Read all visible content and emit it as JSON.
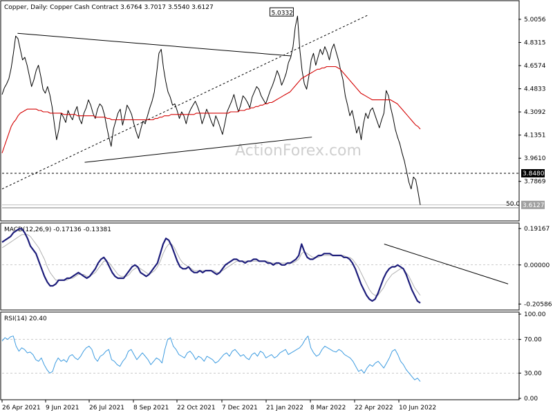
{
  "colors": {
    "price": "#000000",
    "ma": "#d40000",
    "macd": "#1c1c7a",
    "macd_signal": "#b0b0b0",
    "rsi": "#3c9be0",
    "watermark": "#c8c8c8",
    "price_box_bg": "#000000",
    "price_box_bg2": "#a0a0a0"
  },
  "chart_data": [
    {
      "type": "line",
      "panel": "price",
      "title": "Copper, Daily:  Copper Cash Contract  3.6764 3.7017 3.5540 3.6127",
      "watermark": "ActionForex.com",
      "ylim": [
        3.5,
        5.13
      ],
      "y_ticks": [
        "5.0056",
        "4.8315",
        "4.6574",
        "4.4833",
        "4.3092",
        "4.1351",
        "3.9610",
        "3.7869"
      ],
      "x_ticks": [
        "26 Apr 2021",
        "9 Jun 2021",
        "26 Jul 2021",
        "8 Sep 2021",
        "22 Oct 2021",
        "7 Dec 2021",
        "21 Jan 2022",
        "8 Mar 2022",
        "22 Apr 2022",
        "10 Jun 2022"
      ],
      "series": [
        {
          "values": [
            4.44,
            4.49,
            4.52,
            4.56,
            4.64,
            4.75,
            4.88,
            4.86,
            4.78,
            4.7,
            4.72,
            4.66,
            4.58,
            4.5,
            4.55,
            4.62,
            4.66,
            4.58,
            4.48,
            4.45,
            4.5,
            4.44,
            4.35,
            4.22,
            4.1,
            4.18,
            4.3,
            4.27,
            4.23,
            4.32,
            4.28,
            4.25,
            4.31,
            4.35,
            4.26,
            4.22,
            4.3,
            4.34,
            4.4,
            4.36,
            4.3,
            4.26,
            4.33,
            4.37,
            4.35,
            4.29,
            4.2,
            4.12,
            4.05,
            4.18,
            4.24,
            4.3,
            4.33,
            4.21,
            4.28,
            4.36,
            4.33,
            4.29,
            4.22,
            4.16,
            4.11,
            4.18,
            4.24,
            4.22,
            4.28,
            4.34,
            4.39,
            4.46,
            4.6,
            4.75,
            4.78,
            4.64,
            4.54,
            4.46,
            4.42,
            4.36,
            4.37,
            4.32,
            4.26,
            4.31,
            4.28,
            4.22,
            4.29,
            4.33,
            4.36,
            4.39,
            4.35,
            4.3,
            4.22,
            4.27,
            4.33,
            4.29,
            4.24,
            4.2,
            4.28,
            4.24,
            4.19,
            4.14,
            4.22,
            4.31,
            4.35,
            4.39,
            4.44,
            4.37,
            4.31,
            4.36,
            4.43,
            4.41,
            4.38,
            4.34,
            4.42,
            4.46,
            4.5,
            4.48,
            4.43,
            4.4,
            4.37,
            4.42,
            4.47,
            4.51,
            4.56,
            4.62,
            4.58,
            4.51,
            4.55,
            4.6,
            4.68,
            4.72,
            4.8,
            4.95,
            5.03,
            4.78,
            4.62,
            4.52,
            4.48,
            4.58,
            4.7,
            4.75,
            4.66,
            4.72,
            4.78,
            4.74,
            4.8,
            4.76,
            4.7,
            4.78,
            4.82,
            4.76,
            4.7,
            4.62,
            4.55,
            4.43,
            4.36,
            4.28,
            4.32,
            4.24,
            4.15,
            4.2,
            4.1,
            4.22,
            4.3,
            4.26,
            4.32,
            4.34,
            4.29,
            4.24,
            4.19,
            4.25,
            4.3,
            4.47,
            4.43,
            4.34,
            4.27,
            4.18,
            4.12,
            4.07,
            4.0,
            3.94,
            3.86,
            3.78,
            3.73,
            3.82,
            3.8,
            3.71,
            3.61
          ]
        },
        {
          "name": "MA",
          "values": [
            4.0,
            4.05,
            4.1,
            4.15,
            4.2,
            4.23,
            4.25,
            4.28,
            4.3,
            4.31,
            4.32,
            4.33,
            4.33,
            4.33,
            4.33,
            4.33,
            4.32,
            4.32,
            4.31,
            4.31,
            4.31,
            4.3,
            4.3,
            4.3,
            4.3,
            4.3,
            4.3,
            4.29,
            4.29,
            4.29,
            4.29,
            4.29,
            4.29,
            4.28,
            4.28,
            4.28,
            4.28,
            4.28,
            4.28,
            4.28,
            4.28,
            4.27,
            4.27,
            4.27,
            4.27,
            4.27,
            4.26,
            4.26,
            4.25,
            4.25,
            4.25,
            4.25,
            4.25,
            4.25,
            4.25,
            4.25,
            4.25,
            4.25,
            4.25,
            4.25,
            4.25,
            4.25,
            4.25,
            4.25,
            4.25,
            4.25,
            4.25,
            4.26,
            4.26,
            4.27,
            4.27,
            4.28,
            4.28,
            4.28,
            4.29,
            4.29,
            4.29,
            4.29,
            4.29,
            4.29,
            4.29,
            4.29,
            4.29,
            4.29,
            4.29,
            4.3,
            4.3,
            4.3,
            4.3,
            4.3,
            4.3,
            4.3,
            4.3,
            4.3,
            4.3,
            4.3,
            4.3,
            4.3,
            4.3,
            4.3,
            4.31,
            4.31,
            4.31,
            4.31,
            4.32,
            4.32,
            4.32,
            4.33,
            4.33,
            4.34,
            4.34,
            4.35,
            4.35,
            4.36,
            4.36,
            4.37,
            4.37,
            4.38,
            4.38,
            4.39,
            4.4,
            4.41,
            4.42,
            4.43,
            4.44,
            4.45,
            4.46,
            4.48,
            4.5,
            4.52,
            4.54,
            4.56,
            4.57,
            4.58,
            4.59,
            4.6,
            4.61,
            4.62,
            4.63,
            4.63,
            4.64,
            4.64,
            4.65,
            4.65,
            4.65,
            4.65,
            4.65,
            4.64,
            4.63,
            4.61,
            4.59,
            4.57,
            4.55,
            4.53,
            4.51,
            4.49,
            4.47,
            4.45,
            4.44,
            4.43,
            4.42,
            4.41,
            4.4,
            4.4,
            4.4,
            4.4,
            4.4,
            4.4,
            4.4,
            4.4,
            4.4,
            4.39,
            4.38,
            4.37,
            4.35,
            4.33,
            4.31,
            4.29,
            4.27,
            4.25,
            4.23,
            4.21,
            4.2,
            4.18
          ]
        }
      ],
      "annotations": [
        {
          "text": "5.0332"
        },
        {
          "text": "3.8480"
        },
        {
          "text": "3.6127"
        },
        {
          "text": "50.0"
        }
      ],
      "trendlines": [
        {
          "from": [
            0.03,
            4.9
          ],
          "to": [
            0.56,
            4.73
          ]
        },
        {
          "from": [
            0.16,
            3.93
          ],
          "to": [
            0.6,
            4.12
          ]
        },
        {
          "from": [
            0.0,
            3.73
          ],
          "to": [
            0.71,
            5.04
          ],
          "dashed": true
        },
        {
          "from": [
            0.0,
            3.848
          ],
          "to": [
            1.0,
            3.848
          ],
          "dashed": true
        }
      ]
    },
    {
      "type": "line",
      "panel": "macd",
      "title": "MACD(12,26,9) -0.17136 -0.13381",
      "ylim": [
        -0.23,
        0.21
      ],
      "y_ticks": [
        "0.19167",
        "0.00000",
        "-0.20586"
      ],
      "series": [
        {
          "name": "MACD",
          "values": [
            0.12,
            0.13,
            0.14,
            0.15,
            0.17,
            0.18,
            0.19,
            0.19,
            0.17,
            0.14,
            0.1,
            0.08,
            0.06,
            0.02,
            -0.02,
            -0.06,
            -0.09,
            -0.11,
            -0.11,
            -0.1,
            -0.08,
            -0.08,
            -0.08,
            -0.07,
            -0.07,
            -0.06,
            -0.05,
            -0.04,
            -0.05,
            -0.06,
            -0.07,
            -0.06,
            -0.04,
            -0.02,
            0.01,
            0.03,
            0.04,
            0.02,
            -0.01,
            -0.04,
            -0.06,
            -0.07,
            -0.07,
            -0.07,
            -0.05,
            -0.03,
            -0.01,
            0.0,
            -0.01,
            -0.04,
            -0.05,
            -0.06,
            -0.05,
            -0.03,
            -0.01,
            0.01,
            0.06,
            0.11,
            0.14,
            0.13,
            0.1,
            0.06,
            0.02,
            -0.01,
            -0.02,
            -0.02,
            -0.01,
            -0.03,
            -0.04,
            -0.04,
            -0.03,
            -0.04,
            -0.03,
            -0.03,
            -0.03,
            -0.04,
            -0.05,
            -0.04,
            -0.02,
            0.0,
            0.01,
            0.02,
            0.03,
            0.03,
            0.02,
            0.02,
            0.01,
            0.02,
            0.02,
            0.03,
            0.03,
            0.02,
            0.02,
            0.02,
            0.01,
            0.01,
            0.0,
            0.01,
            0.01,
            0.0,
            0.0,
            0.01,
            0.01,
            0.02,
            0.03,
            0.05,
            0.11,
            0.07,
            0.04,
            0.03,
            0.03,
            0.04,
            0.05,
            0.05,
            0.06,
            0.06,
            0.06,
            0.05,
            0.05,
            0.05,
            0.05,
            0.04,
            0.04,
            0.03,
            0.01,
            -0.02,
            -0.06,
            -0.1,
            -0.13,
            -0.16,
            -0.18,
            -0.19,
            -0.18,
            -0.15,
            -0.11,
            -0.07,
            -0.04,
            -0.02,
            -0.01,
            -0.01,
            0.0,
            -0.01,
            -0.02,
            -0.05,
            -0.09,
            -0.13,
            -0.16,
            -0.19,
            -0.2
          ]
        },
        {
          "name": "Signal",
          "values": [
            0.09,
            0.1,
            0.11,
            0.12,
            0.13,
            0.14,
            0.15,
            0.16,
            0.16,
            0.16,
            0.15,
            0.13,
            0.11,
            0.09,
            0.06,
            0.03,
            -0.01,
            -0.04,
            -0.06,
            -0.08,
            -0.08,
            -0.08,
            -0.08,
            -0.08,
            -0.07,
            -0.07,
            -0.06,
            -0.05,
            -0.05,
            -0.05,
            -0.06,
            -0.06,
            -0.05,
            -0.04,
            -0.02,
            0.0,
            0.02,
            0.02,
            0.01,
            -0.01,
            -0.03,
            -0.05,
            -0.06,
            -0.06,
            -0.06,
            -0.05,
            -0.03,
            -0.02,
            -0.01,
            -0.02,
            -0.03,
            -0.04,
            -0.05,
            -0.04,
            -0.03,
            -0.01,
            0.02,
            0.06,
            0.09,
            0.11,
            0.11,
            0.09,
            0.06,
            0.03,
            0.01,
            0.0,
            -0.01,
            -0.02,
            -0.03,
            -0.03,
            -0.03,
            -0.03,
            -0.03,
            -0.03,
            -0.03,
            -0.03,
            -0.04,
            -0.04,
            -0.03,
            -0.02,
            -0.01,
            0.0,
            0.01,
            0.02,
            0.02,
            0.02,
            0.02,
            0.02,
            0.02,
            0.02,
            0.02,
            0.02,
            0.02,
            0.02,
            0.02,
            0.01,
            0.01,
            0.01,
            0.01,
            0.01,
            0.01,
            0.01,
            0.01,
            0.01,
            0.02,
            0.03,
            0.06,
            0.07,
            0.06,
            0.05,
            0.04,
            0.04,
            0.04,
            0.05,
            0.05,
            0.05,
            0.05,
            0.05,
            0.05,
            0.05,
            0.05,
            0.05,
            0.04,
            0.04,
            0.03,
            0.01,
            -0.01,
            -0.04,
            -0.07,
            -0.1,
            -0.13,
            -0.15,
            -0.16,
            -0.16,
            -0.14,
            -0.12,
            -0.09,
            -0.07,
            -0.05,
            -0.04,
            -0.03,
            -0.02,
            -0.02,
            -0.04,
            -0.06,
            -0.09,
            -0.12,
            -0.14,
            -0.16
          ]
        }
      ],
      "trendlines": [
        {
          "from": [
            0.74,
            0.11
          ],
          "to": [
            0.98,
            -0.1
          ]
        }
      ]
    },
    {
      "type": "line",
      "panel": "rsi",
      "title": "RSI(14) 20.40",
      "ylim": [
        0,
        100
      ],
      "y_ticks": [
        "100.00",
        "70.00",
        "30.00",
        "0.00"
      ],
      "series": [
        {
          "name": "RSI",
          "values": [
            68,
            72,
            70,
            73,
            74,
            62,
            56,
            60,
            58,
            54,
            55,
            52,
            46,
            44,
            48,
            40,
            34,
            30,
            32,
            42,
            48,
            44,
            46,
            43,
            50,
            52,
            48,
            46,
            50,
            56,
            60,
            62,
            58,
            48,
            44,
            50,
            52,
            56,
            58,
            46,
            44,
            40,
            38,
            44,
            48,
            56,
            58,
            52,
            46,
            50,
            54,
            50,
            46,
            40,
            44,
            48,
            46,
            42,
            58,
            70,
            72,
            62,
            58,
            52,
            50,
            48,
            54,
            56,
            52,
            46,
            50,
            48,
            44,
            50,
            48,
            46,
            42,
            44,
            48,
            52,
            54,
            50,
            56,
            58,
            54,
            50,
            52,
            48,
            46,
            52,
            54,
            50,
            56,
            54,
            48,
            50,
            52,
            48,
            50,
            54,
            56,
            58,
            52,
            54,
            56,
            58,
            60,
            64,
            70,
            74,
            60,
            54,
            50,
            52,
            58,
            62,
            60,
            58,
            56,
            55,
            58,
            56,
            52,
            50,
            48,
            44,
            38,
            32,
            34,
            30,
            36,
            40,
            38,
            42,
            44,
            40,
            36,
            42,
            48,
            56,
            58,
            52,
            44,
            40,
            34,
            30,
            26,
            22,
            24,
            20
          ]
        }
      ]
    }
  ]
}
